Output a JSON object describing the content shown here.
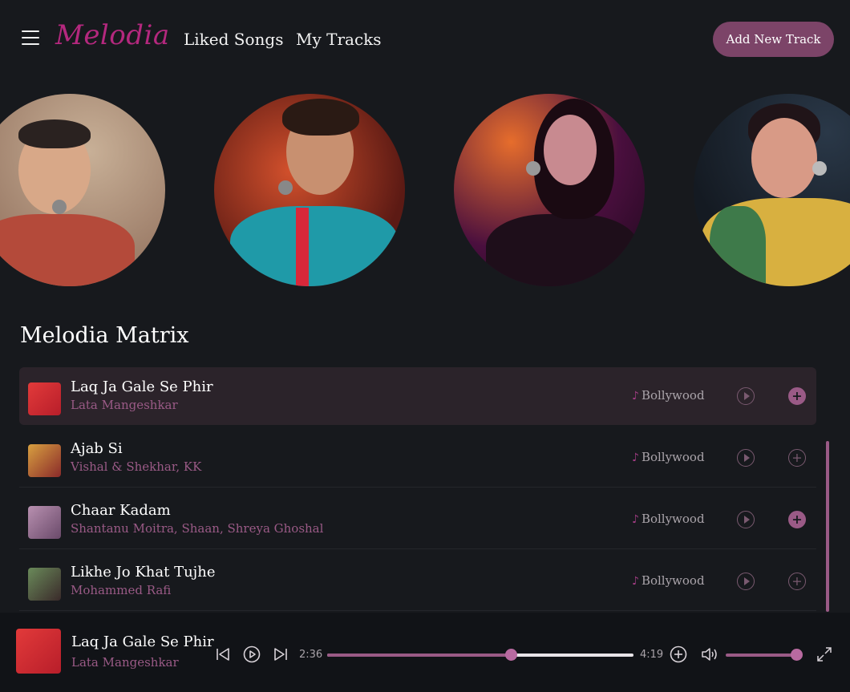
{
  "header": {
    "logo": "Melodia",
    "nav": {
      "liked": "Liked Songs",
      "mine": "My Tracks"
    },
    "add_button": "Add New Track"
  },
  "section_title": "Melodia Matrix",
  "tracks": [
    {
      "title": "Laq Ja Gale Se Phir",
      "artist": "Lata Mangeshkar",
      "genre": "Bollywood",
      "in_library": true,
      "active": true
    },
    {
      "title": "Ajab Si",
      "artist": "Vishal & Shekhar, KK",
      "genre": "Bollywood",
      "in_library": false,
      "active": false
    },
    {
      "title": "Chaar Kadam",
      "artist": "Shantanu Moitra, Shaan, Shreya Ghoshal",
      "genre": "Bollywood",
      "in_library": true,
      "active": false
    },
    {
      "title": "Likhe Jo Khat Tujhe",
      "artist": "Mohammed Rafi",
      "genre": "Bollywood",
      "in_library": false,
      "active": false
    }
  ],
  "player": {
    "title": "Laq Ja Gale Se Phir",
    "artist": "Lata Mangeshkar",
    "elapsed": "2:36",
    "duration": "4:19",
    "progress_fraction": 0.6,
    "volume_fraction": 1.0
  },
  "colors": {
    "accent": "#9a5a86",
    "logo": "#b4287e",
    "background": "#17191d"
  }
}
